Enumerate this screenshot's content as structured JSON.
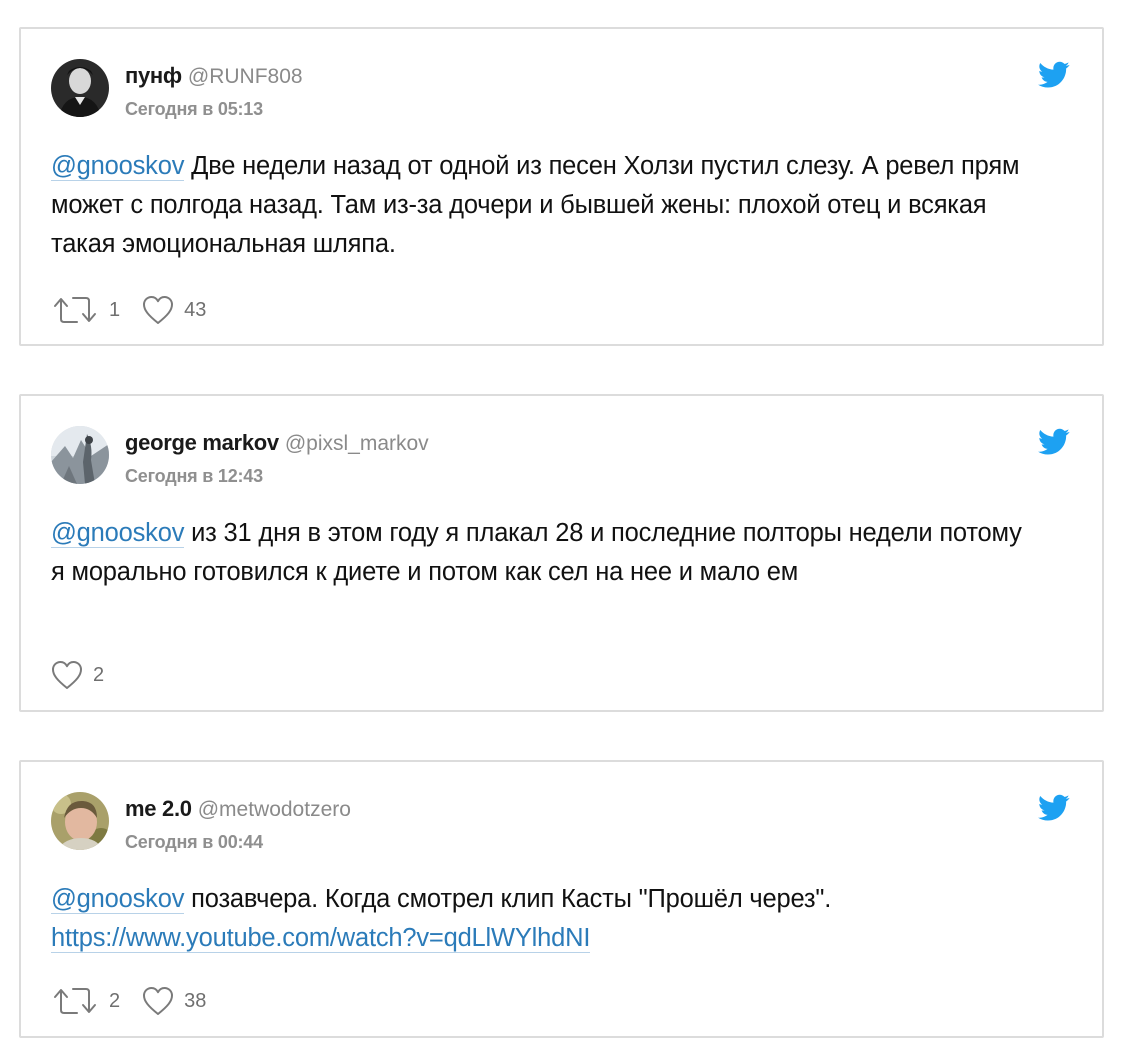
{
  "tweets": [
    {
      "name": "пунф",
      "handle": "@RUNF808",
      "time": "Сегодня в 05:13",
      "mention": "@gnooskov",
      "text": " Две недели назад от одной из песен Холзи пустил слезу. А ревел прям может с полгода назад. Там из-за дочери и бывшей жены: плохой отец и всякая такая эмоциональная шляпа.",
      "retweets": "1",
      "likes": "43"
    },
    {
      "name": "george markov",
      "handle": "@pixsl_markov",
      "time": "Сегодня в 12:43",
      "mention": "@gnooskov",
      "text": " из 31 дня в этом году я плакал 28 и последние полторы недели потому я морально готовился к диете и потом как сел на нее и мало ем",
      "likes": "2"
    },
    {
      "name": "me 2.0",
      "handle": "@metwodotzero",
      "time": "Сегодня в 00:44",
      "mention": "@gnooskov",
      "text": " позавчера. Когда смотрел клип Касты \"Прошёл через\".",
      "url": "https://www.youtube.com/watch?v=qdLlWYlhdNI",
      "retweets": "2",
      "likes": "38"
    }
  ],
  "icons": {
    "brand": "twitter-bird-icon",
    "retweet": "retweet-icon",
    "like": "heart-icon"
  },
  "colors": {
    "link": "#2b7bb9",
    "twitter_blue": "#1da1f2",
    "border": "#dcdcdc",
    "muted": "#8a8a8a"
  }
}
